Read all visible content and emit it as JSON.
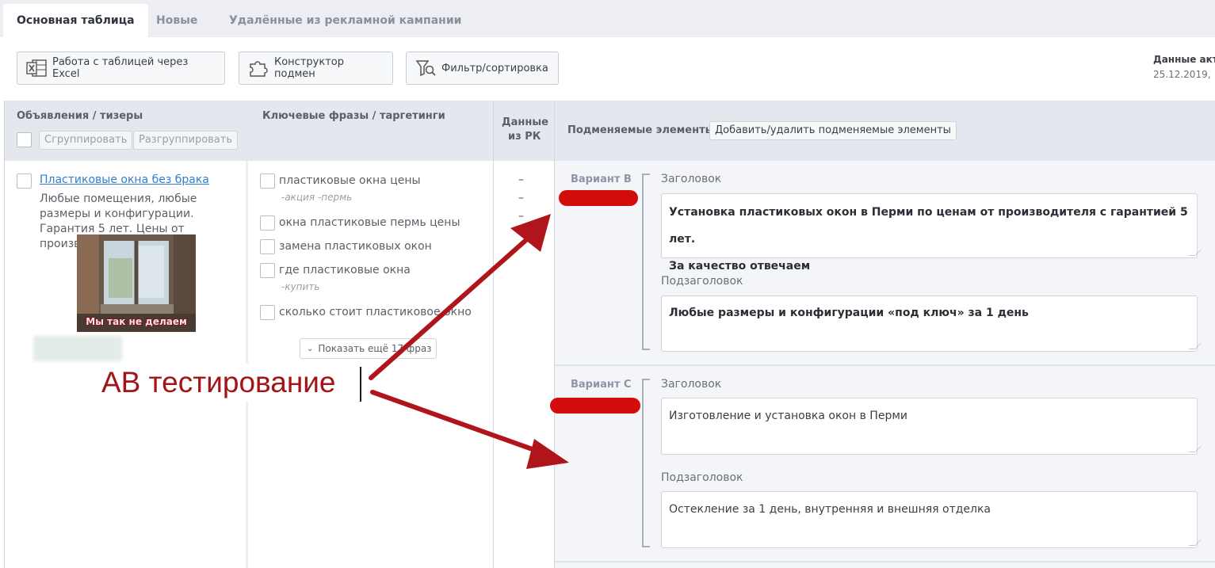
{
  "tabs": [
    {
      "label": "Основная таблица",
      "active": true
    },
    {
      "label": "Новые",
      "active": false
    },
    {
      "label": "Удалённые из рекламной кампании",
      "active": false
    }
  ],
  "toolbar": {
    "excel_label": "Работа с таблицей через Excel",
    "constructor_label": "Конструктор подмен",
    "filter_label": "Фильтр/сортировка",
    "updated_label": "Данные акту",
    "updated_value": "25.12.2019, "
  },
  "columns": {
    "ads_title": "Объявления / тизеры",
    "group_button": "Сгруппировать",
    "ungroup_button": "Разгруппировать",
    "keywords_title": "Ключевые фразы / таргетинги",
    "campaign_data_title_1": "Данные",
    "campaign_data_title_2": "из РК",
    "replaced_title": "Подменяемые элементы",
    "add_remove_button": "Добавить/удалить подменяемые элементы"
  },
  "ad": {
    "title": "Пластиковые окна без брака",
    "text": "Любые помещения, любые размеры и конфигурации. Гарантия 5 лет. Цены от производителя",
    "image_caption": "Мы так не делаем"
  },
  "keywords": [
    {
      "phrase": "пластиковые окна цены",
      "minus": "-акция -пермь"
    },
    {
      "phrase": "окна пластиковые пермь цены",
      "minus": ""
    },
    {
      "phrase": "замена пластиковых окон",
      "minus": ""
    },
    {
      "phrase": "где пластиковые окна",
      "minus": "-купить"
    },
    {
      "phrase": "сколько стоит пластиковое окно",
      "minus": ""
    }
  ],
  "show_more": "Показать ещё 17 фраз",
  "campaign_dashes": [
    "–",
    "–",
    "–"
  ],
  "variants": [
    {
      "name": "Вариант B",
      "headline_label": "Заголовок",
      "headline_line1": "Установка пластиковых окон в Перми по ценам от производителя с гарантией 5 лет.",
      "headline_line2": "За качество отвечаем",
      "subheadline_label": "Подзаголовок",
      "subheadline": "Любые размеры и конфигурации «под ключ» за 1 день"
    },
    {
      "name": "Вариант C",
      "headline_label": "Заголовок",
      "headline_line1": "Изготовление и установка окон в Перми",
      "headline_line2": "",
      "subheadline_label": "Подзаголовок",
      "subheadline": "Остекление за 1 день, внутренняя и внешняя отделка"
    }
  ],
  "annotation": {
    "label": "АВ тестирование",
    "color": "#a31418"
  }
}
